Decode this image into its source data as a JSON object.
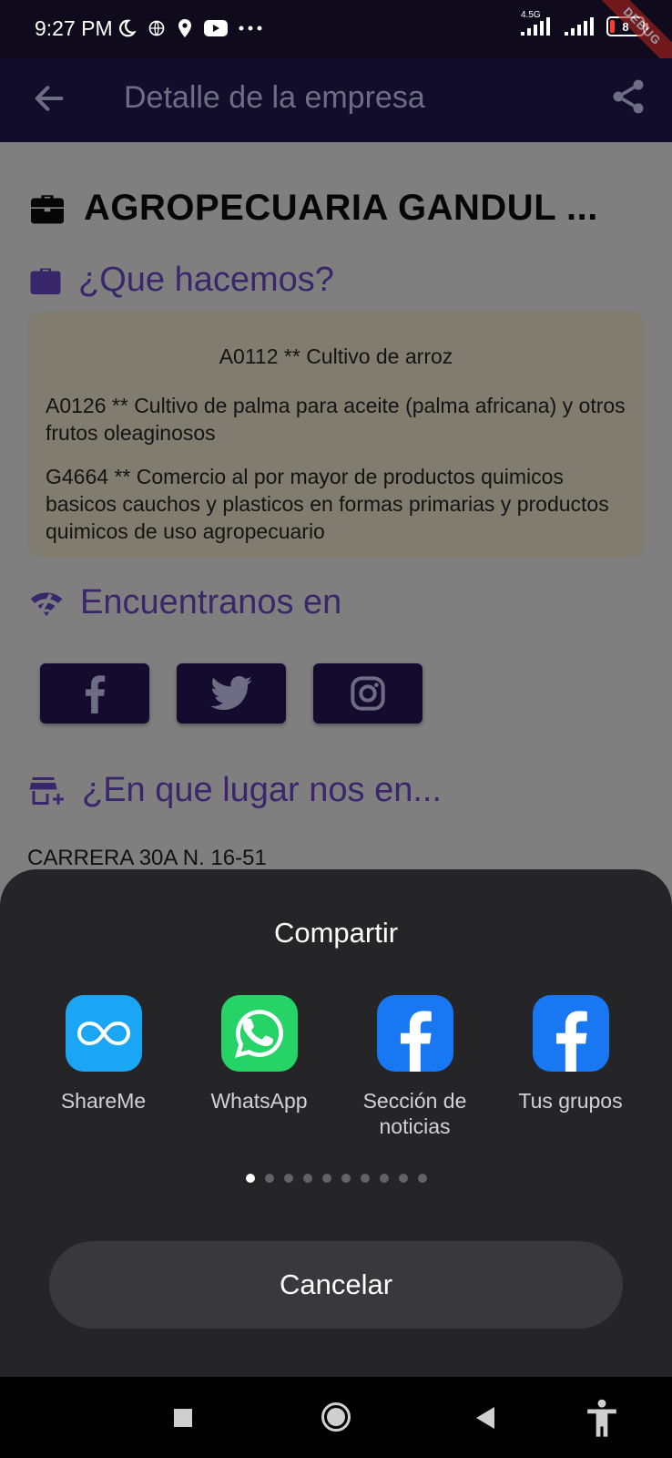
{
  "status_bar": {
    "time": "9:27 PM",
    "network_label": "4.5G",
    "battery_level": "8",
    "debug_label": "DEBUG"
  },
  "app_bar": {
    "title": "Detalle de la empresa",
    "back_icon": "arrow-back-icon",
    "share_icon": "share-icon"
  },
  "company": {
    "name": "AGROPECUARIA GANDUL ...",
    "icon": "briefcase-icon"
  },
  "what_we_do": {
    "title": "¿Que hacemos?",
    "activities": [
      "A0112 ** Cultivo de arroz",
      "A0126 ** Cultivo de palma para aceite (palma africana) y otros frutos oleaginosos",
      "G4664 ** Comercio al por mayor de productos quimicos basicos  cauchos y plasticos en formas primarias y productos quimicos de uso agropecuario"
    ]
  },
  "find_us": {
    "title": "Encuentranos en",
    "social": [
      "facebook-icon",
      "twitter-icon",
      "instagram-icon"
    ]
  },
  "location": {
    "title": "¿En que lugar nos en...",
    "address": "CARRERA 30A N. 16-51"
  },
  "share_sheet": {
    "title": "Compartir",
    "apps": [
      {
        "label": "ShareMe",
        "icon": "shareme-icon",
        "color": "#1aa6f5"
      },
      {
        "label": "WhatsApp",
        "icon": "whatsapp-icon",
        "color": "#25d366"
      },
      {
        "label": "Sección de noticias",
        "icon": "facebook-icon",
        "color": "#1877f2"
      },
      {
        "label": "Tus grupos",
        "icon": "facebook-icon",
        "color": "#1877f2"
      }
    ],
    "page_count": 10,
    "active_page": 1,
    "cancel_label": "Cancelar"
  },
  "colors": {
    "accent": "#5c3ec0",
    "app_bar": "#1d1340",
    "sheet": "#252528"
  }
}
